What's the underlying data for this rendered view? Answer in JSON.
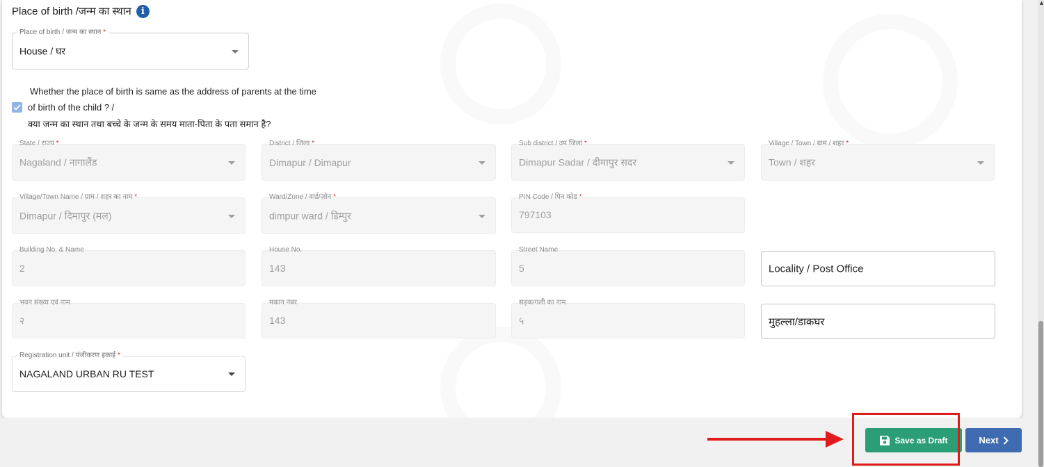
{
  "section": {
    "title": "Place of birth /जन्म का स्थान",
    "info_icon": "info-icon"
  },
  "place_of_birth": {
    "label": "Place of birth / जन्म का स्थान",
    "required": "*",
    "value": "House / घर"
  },
  "same_address": {
    "checked": true,
    "line1": "Whether the place of birth is same as the address of parents at the time",
    "line2": "of birth of the child ? /",
    "line3": "क्या जन्म का स्थान तथा बच्चे के जन्म के समय माता-पिता के पता समान है?"
  },
  "fields": {
    "state": {
      "label": "State / राज्य",
      "required": "*",
      "value": "Nagaland / नागालैंड"
    },
    "district": {
      "label": "District / जिला",
      "required": "*",
      "value": "Dimapur / Dimapur"
    },
    "subdistrict": {
      "label": "Sub district / उप जिला",
      "required": "*",
      "value": "Dimapur Sadar / दीमापुर सदर"
    },
    "village_town": {
      "label": "Village / Town / ग्राम / शहर",
      "required": "*",
      "value": "Town / शहर"
    },
    "village_town_name": {
      "label": "Village/Town Name / ग्राम / शहर का नाम",
      "required": "*",
      "value": "Dimapur / दिमापुर (मल)"
    },
    "ward_zone": {
      "label": "Ward/Zone / वार्ड/ज़ोन",
      "required": "*",
      "value": "dimpur ward / डिम्पुर"
    },
    "pin_code": {
      "label": "PIN Code / पिन कोड",
      "required": "*",
      "value": "797103"
    },
    "building_en": {
      "label": "Building No. & Name",
      "value": "2"
    },
    "house_en": {
      "label": "House No.",
      "value": "143"
    },
    "street_en": {
      "label": "Street Name",
      "value": "5"
    },
    "locality_en": {
      "placeholder": "Locality / Post Office"
    },
    "building_hi": {
      "label": "भवन संख्या एवं नाम",
      "value": "२"
    },
    "house_hi": {
      "label": "मकान नंबर",
      "value": "143"
    },
    "street_hi": {
      "label": "सड़क/गली का नाम",
      "value": "५"
    },
    "locality_hi": {
      "placeholder": "मुहल्ला/डाकघर"
    },
    "registration_unit": {
      "label": "Registration unit / पंजीकरण इकाई",
      "required": "*",
      "value": "NAGALAND URBAN RU TEST"
    }
  },
  "buttons": {
    "save_draft": "Save as Draft",
    "save_icon": "floppy-disk-icon",
    "next": "Next",
    "next_icon": "chevron-right-icon"
  },
  "colors": {
    "save_draft_bg": "#2b9e78",
    "next_bg": "#3f6bb0",
    "annotation": "#e01b1b",
    "checkbox": "#90b4e8",
    "info_icon": "#1f5ea8"
  }
}
